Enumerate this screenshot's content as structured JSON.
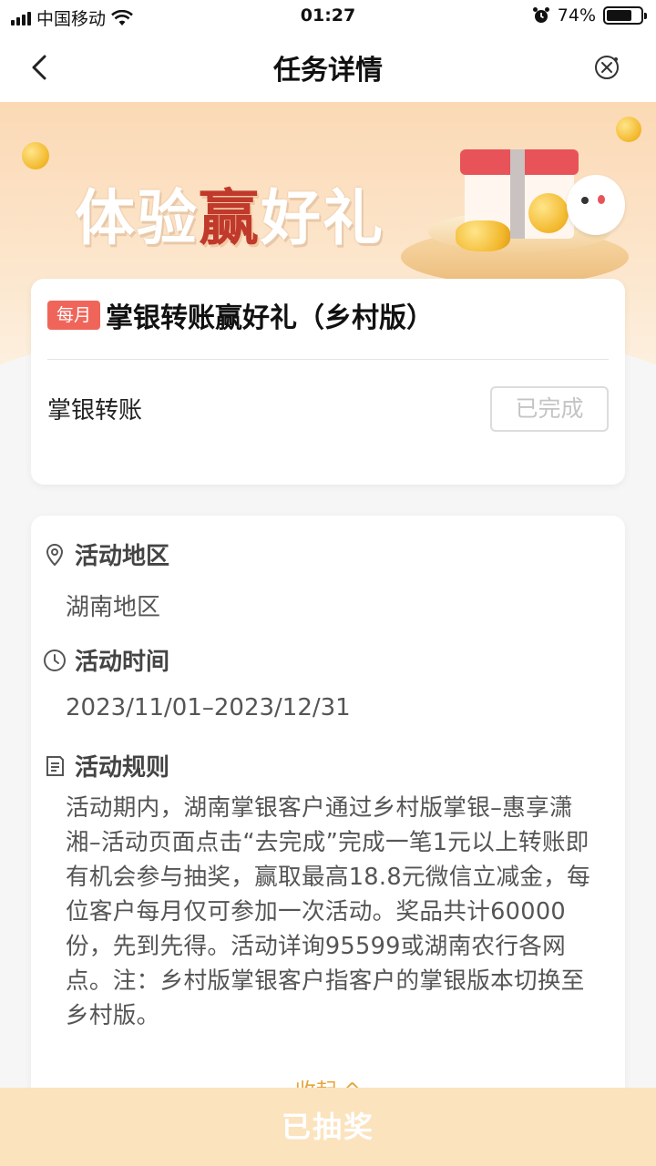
{
  "status_bar": {
    "carrier": "中国移动",
    "time": "01:27",
    "battery": "74%",
    "battery_level": 0.74
  },
  "nav": {
    "title": "任务详情",
    "back_icon": "chevron-left-icon",
    "close_icon": "close-circle-icon"
  },
  "banner": {
    "title_part1": "体验",
    "title_highlight": "赢",
    "title_part2": "好礼"
  },
  "task": {
    "badge": "每月",
    "title": "掌银转账赢好礼（乡村版）",
    "item_name": "掌银转账",
    "status_button": "已完成"
  },
  "info": {
    "region_label": "活动地区",
    "region_value": "湖南地区",
    "time_label": "活动时间",
    "time_value": "2023/11/01–2023/12/31",
    "rules_label": "活动规则",
    "rules_text": "活动期内，湖南掌银客户通过乡村版掌银–惠享潇湘–活动页面点击“去完成”完成一笔1元以上转账即有机会参与抽奖，赢取最高18.8元微信立减金，每位客户每月仅可参加一次活动。奖品共计60000份，先到先得。活动详询95599或湖南农行各网点。注：乡村版掌银客户指客户的掌银版本切换至乡村版。",
    "collapse_label": "收起 ^"
  },
  "bottom": {
    "button_label": "已抽奖"
  },
  "colors": {
    "accent": "#f0655a",
    "gold": "#e8a33a",
    "bottom_button": "#fbe3be"
  }
}
